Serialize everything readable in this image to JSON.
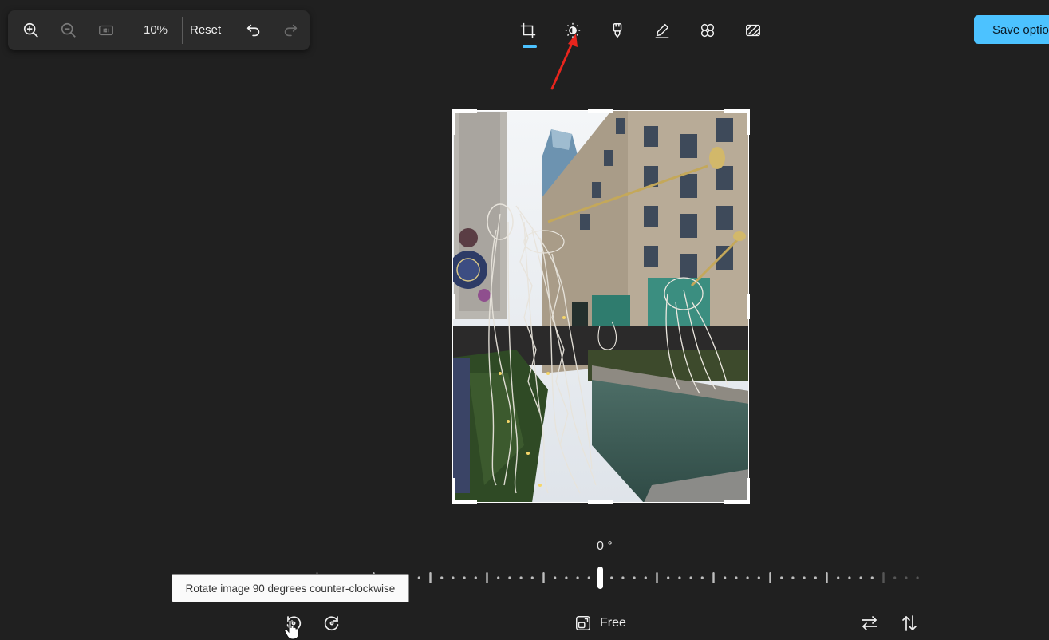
{
  "zoom_bar": {
    "zoom_level": "10%",
    "reset_label": "Reset",
    "icons": [
      "zoom-in-icon",
      "zoom-out-icon",
      "actual-size-icon",
      "undo-icon",
      "redo-icon"
    ]
  },
  "toolbar": {
    "tools": [
      "crop",
      "adjustment",
      "filter",
      "markup",
      "retouch",
      "background-blur"
    ],
    "active_tool": "crop"
  },
  "save": {
    "label": "Save options"
  },
  "crop": {
    "angle_label": "0 °",
    "rotate_ccw_tooltip": "Rotate image 90 degrees counter-clockwise",
    "aspect_label": "Free"
  },
  "colors": {
    "background": "#202020",
    "accent": "#4cc2ff",
    "annotation": "#e8251d"
  }
}
